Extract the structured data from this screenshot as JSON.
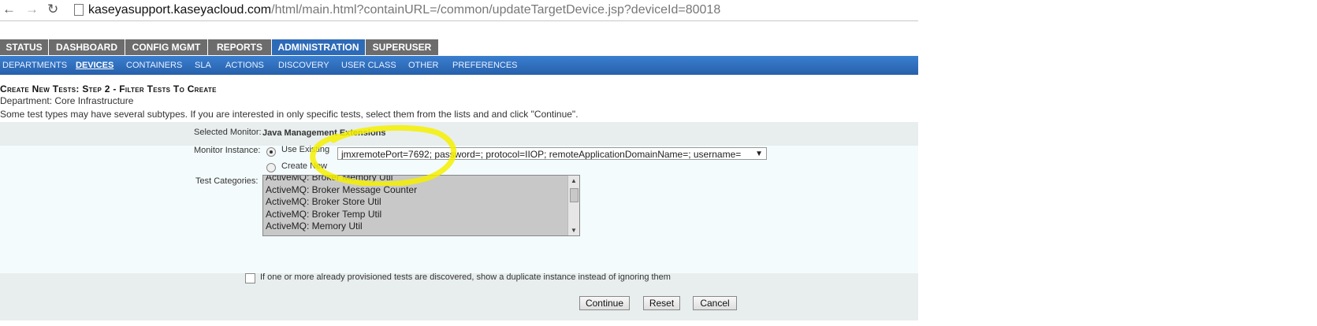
{
  "browser": {
    "back_icon": "back-arrow-icon",
    "forward_icon": "forward-arrow-icon",
    "reload_icon": "reload-icon",
    "url_host": "kaseyasupport.kaseyacloud.com",
    "url_path": "/html/main.html?containURL=/common/updateTargetDevice.jsp?deviceId=80018"
  },
  "tabs": [
    {
      "label": "STATUS",
      "active": false
    },
    {
      "label": "DASHBOARD",
      "active": false
    },
    {
      "label": "CONFIG MGMT",
      "active": false
    },
    {
      "label": "REPORTS",
      "active": false
    },
    {
      "label": "ADMINISTRATION",
      "active": true
    },
    {
      "label": "SUPERUSER",
      "active": false
    }
  ],
  "subnav": [
    {
      "label": "DEPARTMENTS",
      "active": false
    },
    {
      "label": "DEVICES",
      "active": true
    },
    {
      "label": "CONTAINERS",
      "active": false
    },
    {
      "label": "SLA",
      "active": false
    },
    {
      "label": "ACTIONS",
      "active": false
    },
    {
      "label": "DISCOVERY",
      "active": false
    },
    {
      "label": "USER CLASS",
      "active": false
    },
    {
      "label": "OTHER",
      "active": false
    },
    {
      "label": "PREFERENCES",
      "active": false
    }
  ],
  "page": {
    "title": "Create New Tests: Step 2 - Filter Tests To Create",
    "department": "Department: Core Infrastructure",
    "note": "Some test types may have several subtypes. If you are interested in only specific tests, select them from the lists and and click \"Continue\"."
  },
  "form": {
    "selected_monitor_label": "Selected Monitor:",
    "selected_monitor_value": "Java Management Extensions",
    "monitor_instance_label": "Monitor Instance:",
    "use_existing_label": "Use Existing",
    "create_new_label": "Create New",
    "instance_value": "jmxremotePort=7692; password=; protocol=IIOP; remoteApplicationDomainName=; username=",
    "test_categories_label": "Test Categories:",
    "categories": [
      "ActiveMQ: Broker Memory Util",
      "ActiveMQ: Broker Message Counter",
      "ActiveMQ: Broker Store Util",
      "ActiveMQ: Broker Temp Util",
      "ActiveMQ: Memory Util"
    ],
    "duplicate_checkbox_label": "If one or more already provisioned tests are discovered, show a duplicate instance instead of ignoring them"
  },
  "buttons": {
    "continue": "Continue",
    "reset": "Reset",
    "cancel": "Cancel"
  },
  "colors": {
    "active_tab": "#2d6ab7",
    "tab": "#6c6c6c",
    "subnav": "#2760ab",
    "highlight": "#f4f000"
  }
}
